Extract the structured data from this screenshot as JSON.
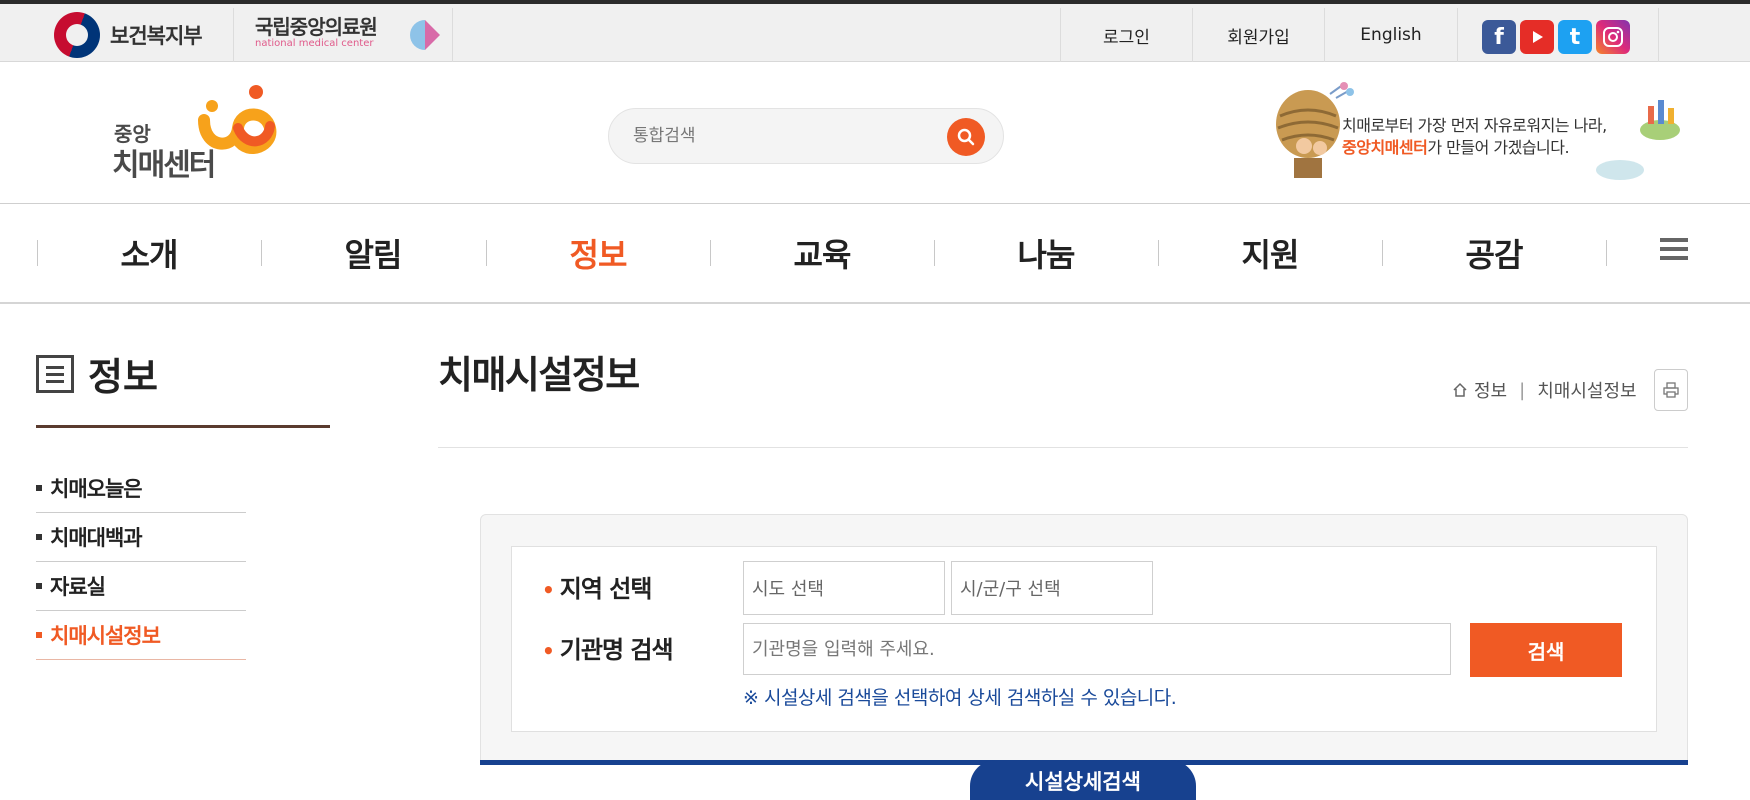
{
  "topbar": {
    "gov_name": "보건복지부",
    "nmc_name": "국립중앙의료원",
    "nmc_sub": "national medical center",
    "links": {
      "login": "로그인",
      "join": "회원가입",
      "english": "English"
    },
    "sns": [
      "facebook-icon",
      "youtube-icon",
      "twitter-icon",
      "instagram-icon"
    ]
  },
  "header": {
    "logo_line1": "중앙",
    "logo_line2": "치매센터",
    "search_placeholder": "통합검색",
    "banner_line1": "치매로부터 가장 먼저 자유로워지는 나라,",
    "banner_highlight": "중앙치매센터",
    "banner_line2_rest": "가 만들어 가겠습니다."
  },
  "gnb": {
    "items": [
      "소개",
      "알림",
      "정보",
      "교육",
      "나눔",
      "지원",
      "공감"
    ],
    "active_index": 2
  },
  "lnb": {
    "title": "정보",
    "items": [
      "치매오늘은",
      "치매대백과",
      "자료실",
      "치매시설정보"
    ],
    "active_index": 3
  },
  "content": {
    "page_title": "치매시설정보",
    "breadcrumb": [
      "정보",
      "치매시설정보"
    ]
  },
  "search_form": {
    "region_label": "지역 선택",
    "sido_placeholder": "시도 선택",
    "sigungu_placeholder": "시/군/구 선택",
    "org_label": "기관명 검색",
    "org_placeholder": "기관명을 입력해 주세요.",
    "submit_label": "검색",
    "notice": "※ 시설상세 검색을 선택하여 상세 검색하실 수 있습니다.",
    "detail_tab": "시설상세검색"
  },
  "colors": {
    "accent": "#f05a24",
    "navy": "#17418f",
    "notice_blue": "#1a4a9a"
  }
}
